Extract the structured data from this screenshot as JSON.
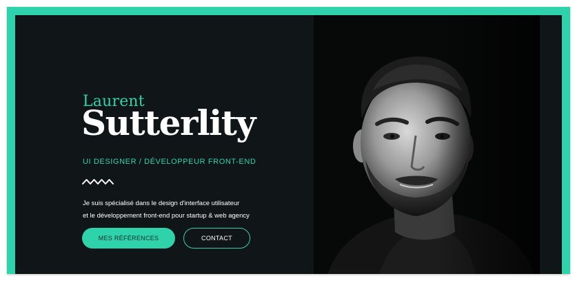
{
  "hero": {
    "first_name": "Laurent",
    "last_name": "Sutterlity",
    "role": "UI DESIGNER / DÉVELOPPEUR FRONT-END",
    "intro_line1": "Je suis spécialisé dans le design d'interface utilisateur",
    "intro_line2": "et le développement front-end pour startup & web agency",
    "primary_button": "MES RÉFÉRENCES",
    "secondary_button": "CONTACT",
    "portrait_icon": "portrait-photo",
    "divider_icon": "zigzag-divider-icon"
  },
  "colors": {
    "accent": "#2ed3ab",
    "background": "#101618",
    "text": "#ffffff"
  }
}
